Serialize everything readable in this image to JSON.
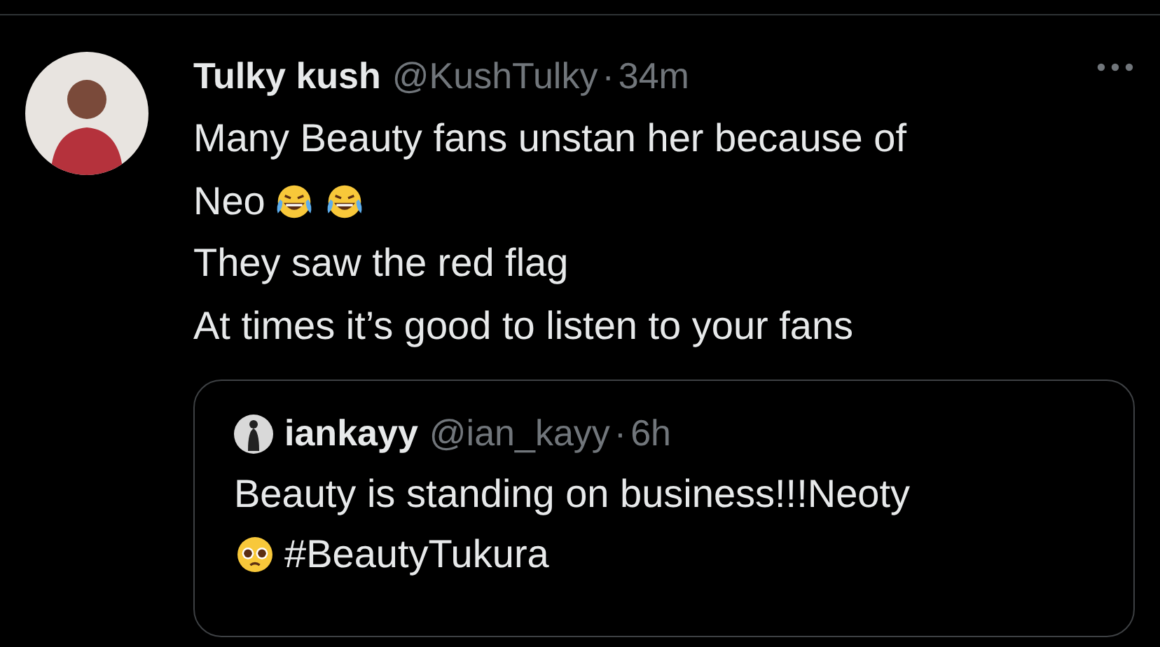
{
  "tweet": {
    "author": {
      "name": "Tulky kush",
      "handle": "@KushTulky",
      "separator": "·",
      "time": "34m"
    },
    "body": [
      [
        {
          "kind": "text",
          "text": "Many Beauty fans unstan her because of"
        }
      ],
      [
        {
          "kind": "text",
          "text": "Neo"
        },
        {
          "kind": "laugh_emoji"
        },
        {
          "kind": "laugh_emoji"
        }
      ],
      [
        {
          "kind": "text",
          "text": "They saw the red flag"
        }
      ],
      [
        {
          "kind": "text",
          "text": "At times it’s good to listen to your fans"
        }
      ]
    ],
    "quote": {
      "author": {
        "name": "iankayy",
        "handle": "@ian_kayy",
        "separator": "·",
        "time": "6h"
      },
      "body": [
        [
          {
            "kind": "text",
            "text": "Beauty is standing on business!!!Neoty"
          }
        ],
        [
          {
            "kind": "plead_emoji"
          },
          {
            "kind": "text",
            "text": "#BeautyTukura"
          }
        ]
      ]
    }
  }
}
